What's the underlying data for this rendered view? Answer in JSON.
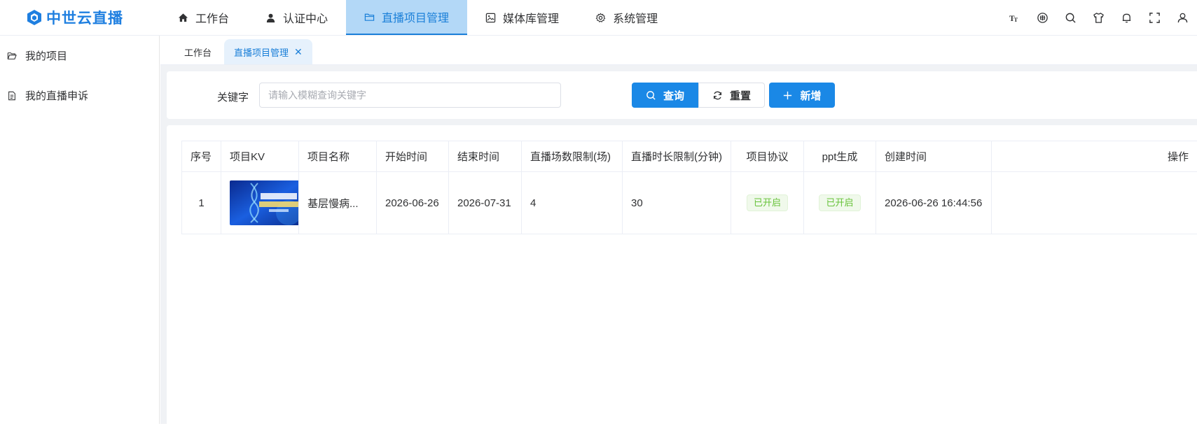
{
  "app": {
    "brand": "中世云直播",
    "brand_color": "#1f7fe0",
    "accent": "#1a88e6"
  },
  "nav": {
    "items": [
      {
        "label": "工作台",
        "icon": "home-icon",
        "active": false
      },
      {
        "label": "认证中心",
        "icon": "user-icon",
        "active": false
      },
      {
        "label": "直播项目管理",
        "icon": "folder-icon",
        "active": true
      },
      {
        "label": "媒体库管理",
        "icon": "media-library-icon",
        "active": false
      },
      {
        "label": "系统管理",
        "icon": "gear-icon",
        "active": false
      }
    ]
  },
  "toolbar": {
    "icons": [
      "font-size-icon",
      "language-icon",
      "search-icon",
      "theme-shirt-icon",
      "bell-icon",
      "fullscreen-icon",
      "user-profile-icon"
    ]
  },
  "sidebar": {
    "items": [
      {
        "label": "我的项目",
        "icon": "folder-open-icon"
      },
      {
        "label": "我的直播申诉",
        "icon": "document-icon"
      }
    ]
  },
  "tabs": [
    {
      "label": "工作台",
      "active": false
    },
    {
      "label": "直播项目管理",
      "active": true,
      "closable": true
    }
  ],
  "search": {
    "keyword_label": "关键字",
    "keyword_placeholder": "请输入模糊查询关键字",
    "keyword_value": "",
    "query_label": "查询",
    "reset_label": "重置",
    "add_label": "新增"
  },
  "table": {
    "columns": [
      "序号",
      "项目KV",
      "项目名称",
      "开始时间",
      "结束时间",
      "直播场数限制(场)",
      "直播时长限制(分钟)",
      "项目协议",
      "ppt生成",
      "创建时间",
      "操作"
    ],
    "rows": [
      {
        "index": "1",
        "name": "基层慢病...",
        "start": "2026-06-26",
        "end": "2026-07-31",
        "session_limit": "4",
        "duration_limit": "30",
        "agreement": "已开启",
        "ppt": "已开启",
        "created": "2026-06-26 16:44:56",
        "kv_text": "基层慢病防治能力提升"
      }
    ]
  }
}
